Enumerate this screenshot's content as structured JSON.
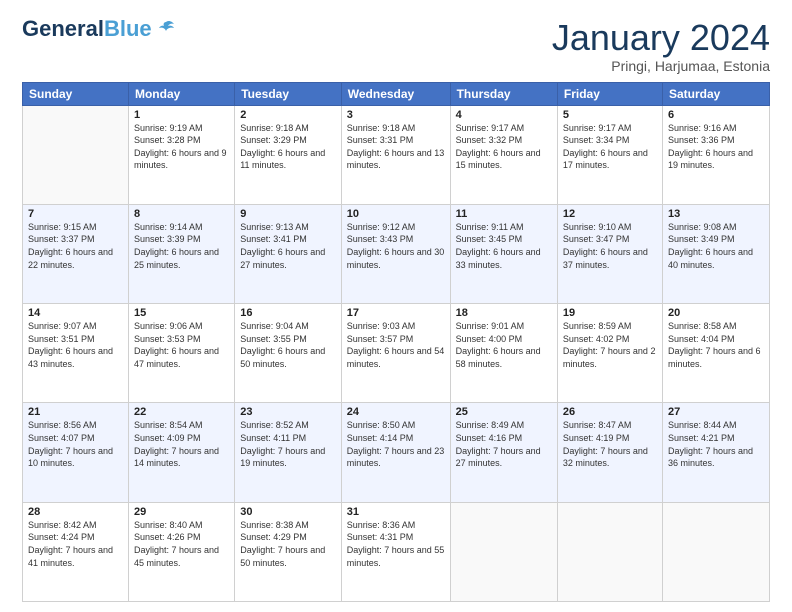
{
  "logo": {
    "line1": "General",
    "line2": "Blue"
  },
  "header": {
    "title": "January 2024",
    "subtitle": "Pringi, Harjumaa, Estonia"
  },
  "weekdays": [
    "Sunday",
    "Monday",
    "Tuesday",
    "Wednesday",
    "Thursday",
    "Friday",
    "Saturday"
  ],
  "weeks": [
    [
      {
        "day": "",
        "sunrise": "",
        "sunset": "",
        "daylight": ""
      },
      {
        "day": "1",
        "sunrise": "Sunrise: 9:19 AM",
        "sunset": "Sunset: 3:28 PM",
        "daylight": "Daylight: 6 hours and 9 minutes."
      },
      {
        "day": "2",
        "sunrise": "Sunrise: 9:18 AM",
        "sunset": "Sunset: 3:29 PM",
        "daylight": "Daylight: 6 hours and 11 minutes."
      },
      {
        "day": "3",
        "sunrise": "Sunrise: 9:18 AM",
        "sunset": "Sunset: 3:31 PM",
        "daylight": "Daylight: 6 hours and 13 minutes."
      },
      {
        "day": "4",
        "sunrise": "Sunrise: 9:17 AM",
        "sunset": "Sunset: 3:32 PM",
        "daylight": "Daylight: 6 hours and 15 minutes."
      },
      {
        "day": "5",
        "sunrise": "Sunrise: 9:17 AM",
        "sunset": "Sunset: 3:34 PM",
        "daylight": "Daylight: 6 hours and 17 minutes."
      },
      {
        "day": "6",
        "sunrise": "Sunrise: 9:16 AM",
        "sunset": "Sunset: 3:36 PM",
        "daylight": "Daylight: 6 hours and 19 minutes."
      }
    ],
    [
      {
        "day": "7",
        "sunrise": "Sunrise: 9:15 AM",
        "sunset": "Sunset: 3:37 PM",
        "daylight": "Daylight: 6 hours and 22 minutes."
      },
      {
        "day": "8",
        "sunrise": "Sunrise: 9:14 AM",
        "sunset": "Sunset: 3:39 PM",
        "daylight": "Daylight: 6 hours and 25 minutes."
      },
      {
        "day": "9",
        "sunrise": "Sunrise: 9:13 AM",
        "sunset": "Sunset: 3:41 PM",
        "daylight": "Daylight: 6 hours and 27 minutes."
      },
      {
        "day": "10",
        "sunrise": "Sunrise: 9:12 AM",
        "sunset": "Sunset: 3:43 PM",
        "daylight": "Daylight: 6 hours and 30 minutes."
      },
      {
        "day": "11",
        "sunrise": "Sunrise: 9:11 AM",
        "sunset": "Sunset: 3:45 PM",
        "daylight": "Daylight: 6 hours and 33 minutes."
      },
      {
        "day": "12",
        "sunrise": "Sunrise: 9:10 AM",
        "sunset": "Sunset: 3:47 PM",
        "daylight": "Daylight: 6 hours and 37 minutes."
      },
      {
        "day": "13",
        "sunrise": "Sunrise: 9:08 AM",
        "sunset": "Sunset: 3:49 PM",
        "daylight": "Daylight: 6 hours and 40 minutes."
      }
    ],
    [
      {
        "day": "14",
        "sunrise": "Sunrise: 9:07 AM",
        "sunset": "Sunset: 3:51 PM",
        "daylight": "Daylight: 6 hours and 43 minutes."
      },
      {
        "day": "15",
        "sunrise": "Sunrise: 9:06 AM",
        "sunset": "Sunset: 3:53 PM",
        "daylight": "Daylight: 6 hours and 47 minutes."
      },
      {
        "day": "16",
        "sunrise": "Sunrise: 9:04 AM",
        "sunset": "Sunset: 3:55 PM",
        "daylight": "Daylight: 6 hours and 50 minutes."
      },
      {
        "day": "17",
        "sunrise": "Sunrise: 9:03 AM",
        "sunset": "Sunset: 3:57 PM",
        "daylight": "Daylight: 6 hours and 54 minutes."
      },
      {
        "day": "18",
        "sunrise": "Sunrise: 9:01 AM",
        "sunset": "Sunset: 4:00 PM",
        "daylight": "Daylight: 6 hours and 58 minutes."
      },
      {
        "day": "19",
        "sunrise": "Sunrise: 8:59 AM",
        "sunset": "Sunset: 4:02 PM",
        "daylight": "Daylight: 7 hours and 2 minutes."
      },
      {
        "day": "20",
        "sunrise": "Sunrise: 8:58 AM",
        "sunset": "Sunset: 4:04 PM",
        "daylight": "Daylight: 7 hours and 6 minutes."
      }
    ],
    [
      {
        "day": "21",
        "sunrise": "Sunrise: 8:56 AM",
        "sunset": "Sunset: 4:07 PM",
        "daylight": "Daylight: 7 hours and 10 minutes."
      },
      {
        "day": "22",
        "sunrise": "Sunrise: 8:54 AM",
        "sunset": "Sunset: 4:09 PM",
        "daylight": "Daylight: 7 hours and 14 minutes."
      },
      {
        "day": "23",
        "sunrise": "Sunrise: 8:52 AM",
        "sunset": "Sunset: 4:11 PM",
        "daylight": "Daylight: 7 hours and 19 minutes."
      },
      {
        "day": "24",
        "sunrise": "Sunrise: 8:50 AM",
        "sunset": "Sunset: 4:14 PM",
        "daylight": "Daylight: 7 hours and 23 minutes."
      },
      {
        "day": "25",
        "sunrise": "Sunrise: 8:49 AM",
        "sunset": "Sunset: 4:16 PM",
        "daylight": "Daylight: 7 hours and 27 minutes."
      },
      {
        "day": "26",
        "sunrise": "Sunrise: 8:47 AM",
        "sunset": "Sunset: 4:19 PM",
        "daylight": "Daylight: 7 hours and 32 minutes."
      },
      {
        "day": "27",
        "sunrise": "Sunrise: 8:44 AM",
        "sunset": "Sunset: 4:21 PM",
        "daylight": "Daylight: 7 hours and 36 minutes."
      }
    ],
    [
      {
        "day": "28",
        "sunrise": "Sunrise: 8:42 AM",
        "sunset": "Sunset: 4:24 PM",
        "daylight": "Daylight: 7 hours and 41 minutes."
      },
      {
        "day": "29",
        "sunrise": "Sunrise: 8:40 AM",
        "sunset": "Sunset: 4:26 PM",
        "daylight": "Daylight: 7 hours and 45 minutes."
      },
      {
        "day": "30",
        "sunrise": "Sunrise: 8:38 AM",
        "sunset": "Sunset: 4:29 PM",
        "daylight": "Daylight: 7 hours and 50 minutes."
      },
      {
        "day": "31",
        "sunrise": "Sunrise: 8:36 AM",
        "sunset": "Sunset: 4:31 PM",
        "daylight": "Daylight: 7 hours and 55 minutes."
      },
      {
        "day": "",
        "sunrise": "",
        "sunset": "",
        "daylight": ""
      },
      {
        "day": "",
        "sunrise": "",
        "sunset": "",
        "daylight": ""
      },
      {
        "day": "",
        "sunrise": "",
        "sunset": "",
        "daylight": ""
      }
    ]
  ]
}
